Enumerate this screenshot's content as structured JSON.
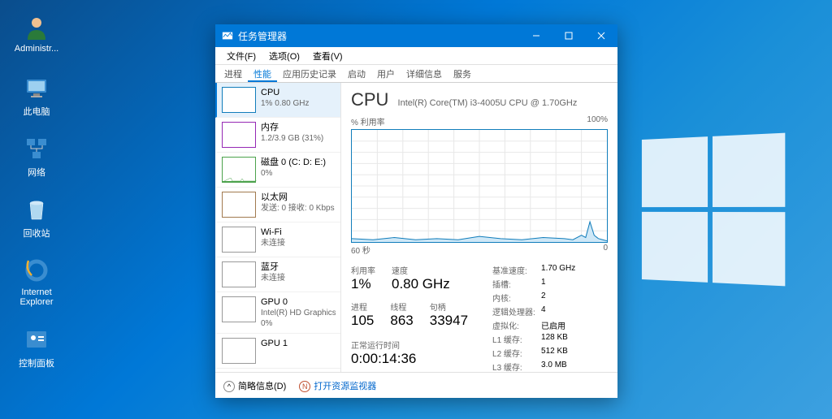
{
  "desktop": {
    "icons": [
      "Administr...",
      "此电脑",
      "网络",
      "回收站",
      "Internet Explorer",
      "控制面板"
    ]
  },
  "window": {
    "title": "任务管理器",
    "menu": [
      "文件(F)",
      "选项(O)",
      "查看(V)"
    ],
    "tabs": [
      "进程",
      "性能",
      "应用历史记录",
      "启动",
      "用户",
      "详细信息",
      "服务"
    ],
    "activeTab": 1
  },
  "sidebar": [
    {
      "name": "CPU",
      "sub": "1% 0.80 GHz"
    },
    {
      "name": "内存",
      "sub": "1.2/3.9 GB (31%)"
    },
    {
      "name": "磁盘 0 (C: D: E:)",
      "sub": "0%"
    },
    {
      "name": "以太网",
      "sub": "发送: 0 接收: 0 Kbps"
    },
    {
      "name": "Wi-Fi",
      "sub": "未连接"
    },
    {
      "name": "蓝牙",
      "sub": "未连接"
    },
    {
      "name": "GPU 0",
      "sub": "Intel(R) HD Graphics",
      "sub2": "0%"
    },
    {
      "name": "GPU 1",
      "sub": ""
    }
  ],
  "main": {
    "title": "CPU",
    "subtitle": "Intel(R) Core(TM) i3-4005U CPU @ 1.70GHz",
    "graphLabel": "% 利用率",
    "graphMax": "100%",
    "graphXLeft": "60 秒",
    "graphXRight": "0",
    "util_label": "利用率",
    "util": "1%",
    "speed_label": "速度",
    "speed": "0.80 GHz",
    "proc_label": "进程",
    "proc": "105",
    "threads_label": "线程",
    "threads": "863",
    "handles_label": "句柄",
    "handles": "33947",
    "uptime_label": "正常运行时间",
    "uptime": "0:00:14:36",
    "specs": [
      [
        "基准速度:",
        "1.70 GHz"
      ],
      [
        "插槽:",
        "1"
      ],
      [
        "内核:",
        "2"
      ],
      [
        "逻辑处理器:",
        "4"
      ],
      [
        "虚拟化:",
        "已启用"
      ],
      [
        "L1 缓存:",
        "128 KB"
      ],
      [
        "L2 缓存:",
        "512 KB"
      ],
      [
        "L3 缓存:",
        "3.0 MB"
      ]
    ]
  },
  "footer": {
    "brief": "简略信息(D)",
    "resmon": "打开资源监视器"
  },
  "chart_data": {
    "type": "line",
    "title": "% 利用率",
    "xlabel": "60 秒 → 0",
    "ylabel": "% 利用率",
    "ylim": [
      0,
      100
    ],
    "x": [
      60,
      55,
      50,
      45,
      40,
      35,
      30,
      25,
      20,
      15,
      10,
      8,
      6,
      5,
      4,
      3,
      2,
      1,
      0
    ],
    "values": [
      3,
      2,
      4,
      2,
      3,
      2,
      5,
      3,
      2,
      4,
      3,
      2,
      6,
      4,
      18,
      6,
      3,
      2,
      1
    ]
  }
}
